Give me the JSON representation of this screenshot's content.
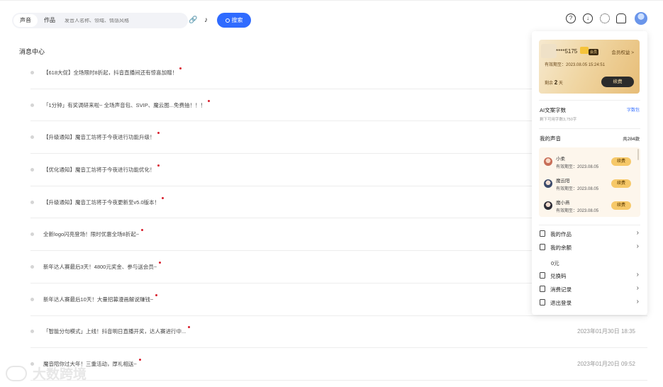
{
  "search": {
    "tabs": [
      "声音",
      "作品"
    ],
    "placeholder": "发音人名称、领域、情感风格",
    "button_label": "搜索"
  },
  "messages": {
    "title": "消息中心",
    "items": [
      {
        "text": "【618大促】全场限时8折起，抖音直播间还有惊喜加赠！",
        "time": ""
      },
      {
        "text": "「1分钟」有奖调研来啦~ 全场声音包、SVIP、魔云图...免费抽！！！",
        "time": ""
      },
      {
        "text": "【升级通知】魔音工坊将于今夜进行功能升级！",
        "time": ""
      },
      {
        "text": "【优化通知】魔音工坊将于今夜进行功能优化！",
        "time": ""
      },
      {
        "text": "【升级通知】魔音工坊将于今夜更新至v5.0版本！",
        "time": ""
      },
      {
        "text": "全新logo闪亮登场！限时优惠全场8折起~",
        "time": ""
      },
      {
        "text": "新年达人赛最后3天！4800元奖金、参与送会员~",
        "time": ""
      },
      {
        "text": "新年达人赛最后10天！大量招募漫画解说赚钱~",
        "time": ""
      },
      {
        "text": "「智能分句模式」上线！抖音明日直播开奖，达人赛进行中...",
        "time": "2023年01月30日 18:35"
      },
      {
        "text": "魔音陪你过大年！三重活动，厚礼相送~",
        "time": "2023年01月20日 09:52"
      }
    ]
  },
  "panel": {
    "vip": {
      "account": "****5175",
      "tag": "会员",
      "rights_link": "会员权益 >",
      "expire": "有效期至：2023.08.05 15:24:51",
      "remain_prefix": "剩余",
      "remain_value": "2",
      "remain_suffix": "天",
      "renew": "续费"
    },
    "ai": {
      "title": "AI文案字数",
      "link": "字数包",
      "sub": "剩下可用字数3,750字"
    },
    "voices": {
      "title": "我的声音",
      "count": "共284款",
      "items": [
        {
          "name": "小柔",
          "expire": "有效期至：2023.08.05",
          "renew": "续费"
        },
        {
          "name": "魔云阳",
          "expire": "有效期至：2023.08.05",
          "renew": "续费"
        },
        {
          "name": "魔小燕",
          "expire": "有效期至：2023.08.05",
          "renew": "续费"
        }
      ]
    },
    "menu": {
      "works": "我的作品",
      "balance": "我的余额",
      "balance_value": "0元",
      "redeem": "兑换码",
      "records": "消费记录",
      "logout": "退出登录"
    }
  },
  "watermark": "大数跨境"
}
